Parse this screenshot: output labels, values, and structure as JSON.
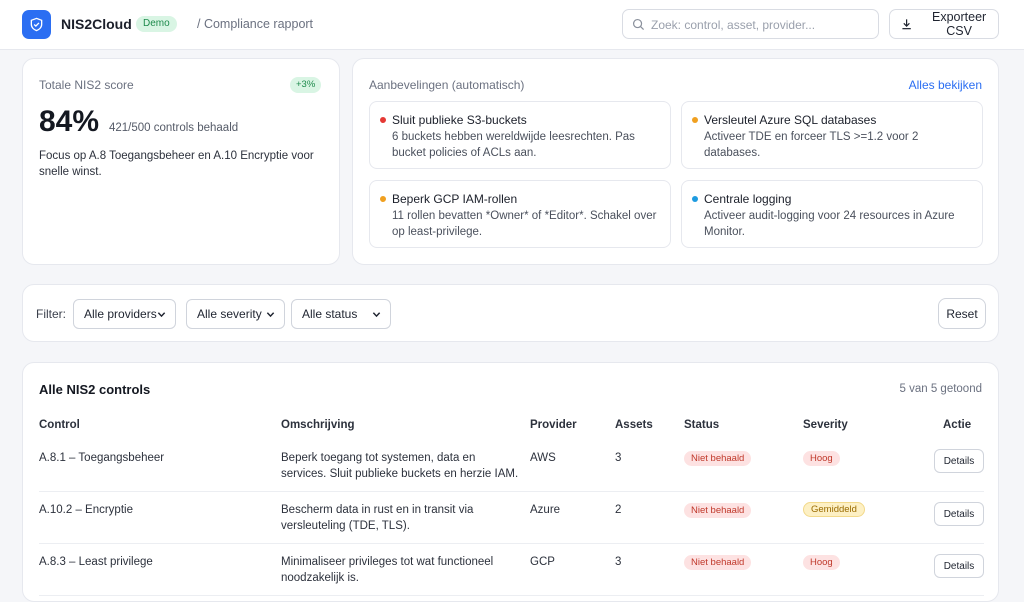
{
  "header": {
    "brand": "NIS2Cloud",
    "env_badge": "Demo",
    "breadcrumb": "/ Compliance rapport",
    "search_placeholder": "Zoek: control, asset, provider...",
    "export_label": "Exporteer CSV",
    "logo_icon": "shield-check-icon",
    "brand_color": "#2b6ef2"
  },
  "score": {
    "label": "Totale NIS2 score",
    "delta": "+3%",
    "value": "84%",
    "controls": "421/500 controls behaald",
    "focus": "Focus op A.8 Toegangsbeheer en A.10 Encryptie voor snelle winst."
  },
  "recommendations": {
    "title": "Aanbevelingen (automatisch)",
    "view_all": "Alles bekijken",
    "items": [
      {
        "title": "Sluit publieke S3-buckets",
        "body": "6 buckets hebben wereldwijde leesrechten. Pas bucket policies of ACLs aan.",
        "color": "#e53935"
      },
      {
        "title": "Versleutel Azure SQL databases",
        "body": "Activeer TDE en forceer TLS >=1.2 voor 2 databases.",
        "color": "#f0a020"
      },
      {
        "title": "Beperk GCP IAM-rollen",
        "body": "11 rollen bevatten *Owner* of *Editor*. Schakel over op least-privilege.",
        "color": "#f0a020"
      },
      {
        "title": "Centrale logging",
        "body": "Activeer audit-logging voor 24 resources in Azure Monitor.",
        "color": "#1e9be0"
      }
    ]
  },
  "filters": {
    "label": "Filter:",
    "provider": "Alle providers",
    "severity": "Alle severity",
    "status": "Alle status",
    "reset": "Reset"
  },
  "table": {
    "title": "Alle NIS2 controls",
    "count": "5 van 5 getoond",
    "headers": {
      "control": "Control",
      "description": "Omschrijving",
      "provider": "Provider",
      "assets": "Assets",
      "status": "Status",
      "severity": "Severity",
      "action": "Actie"
    },
    "rows": [
      {
        "control": "A.8.1 – Toegangsbeheer",
        "description": "Beperk toegang tot systemen, data en services. Sluit publieke buckets en herzie IAM.",
        "provider": "AWS",
        "assets": "3",
        "status": "Niet behaald",
        "severity": "Hoog",
        "action": "Details"
      },
      {
        "control": "A.10.2 – Encryptie",
        "description": "Bescherm data in rust en in transit via versleuteling (TDE, TLS).",
        "provider": "Azure",
        "assets": "2",
        "status": "Niet behaald",
        "severity": "Gemiddeld",
        "action": "Details"
      },
      {
        "control": "A.8.3 – Least privilege",
        "description": "Minimaliseer privileges tot wat functioneel noodzakelijk is.",
        "provider": "GCP",
        "assets": "3",
        "status": "Niet behaald",
        "severity": "Hoog",
        "action": "Details"
      }
    ]
  }
}
